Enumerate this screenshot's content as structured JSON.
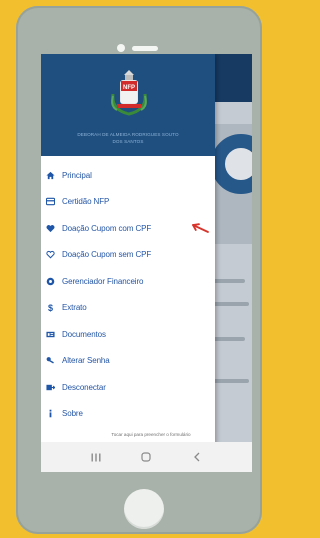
{
  "drawer": {
    "user_name": "DEBORAH DE ALMEIDA RODRIGUES SOUTO",
    "user_name_line2": "DOS SANTOS",
    "items": [
      {
        "label": "Principal",
        "icon": "home-icon"
      },
      {
        "label": "Certidão NFP",
        "icon": "certificate-icon"
      },
      {
        "label": "Doação Cupom com CPF",
        "icon": "heart-filled-icon"
      },
      {
        "label": "Doação Cupom sem CPF",
        "icon": "heart-outline-icon"
      },
      {
        "label": "Gerenciador Financeiro",
        "icon": "finance-icon"
      },
      {
        "label": "Extrato",
        "icon": "dollar-icon"
      },
      {
        "label": "Documentos",
        "icon": "documents-icon"
      },
      {
        "label": "Alterar Senha",
        "icon": "key-icon"
      },
      {
        "label": "Desconectar",
        "icon": "logout-icon"
      },
      {
        "label": "Sobre",
        "icon": "info-icon"
      }
    ]
  },
  "toast": {
    "text": "Tocar aqui para preencher o formulário"
  },
  "colors": {
    "accent": "#2456a6",
    "header": "#1f4f7f",
    "background": "#f2bf2e",
    "arrow": "#d9342b"
  }
}
